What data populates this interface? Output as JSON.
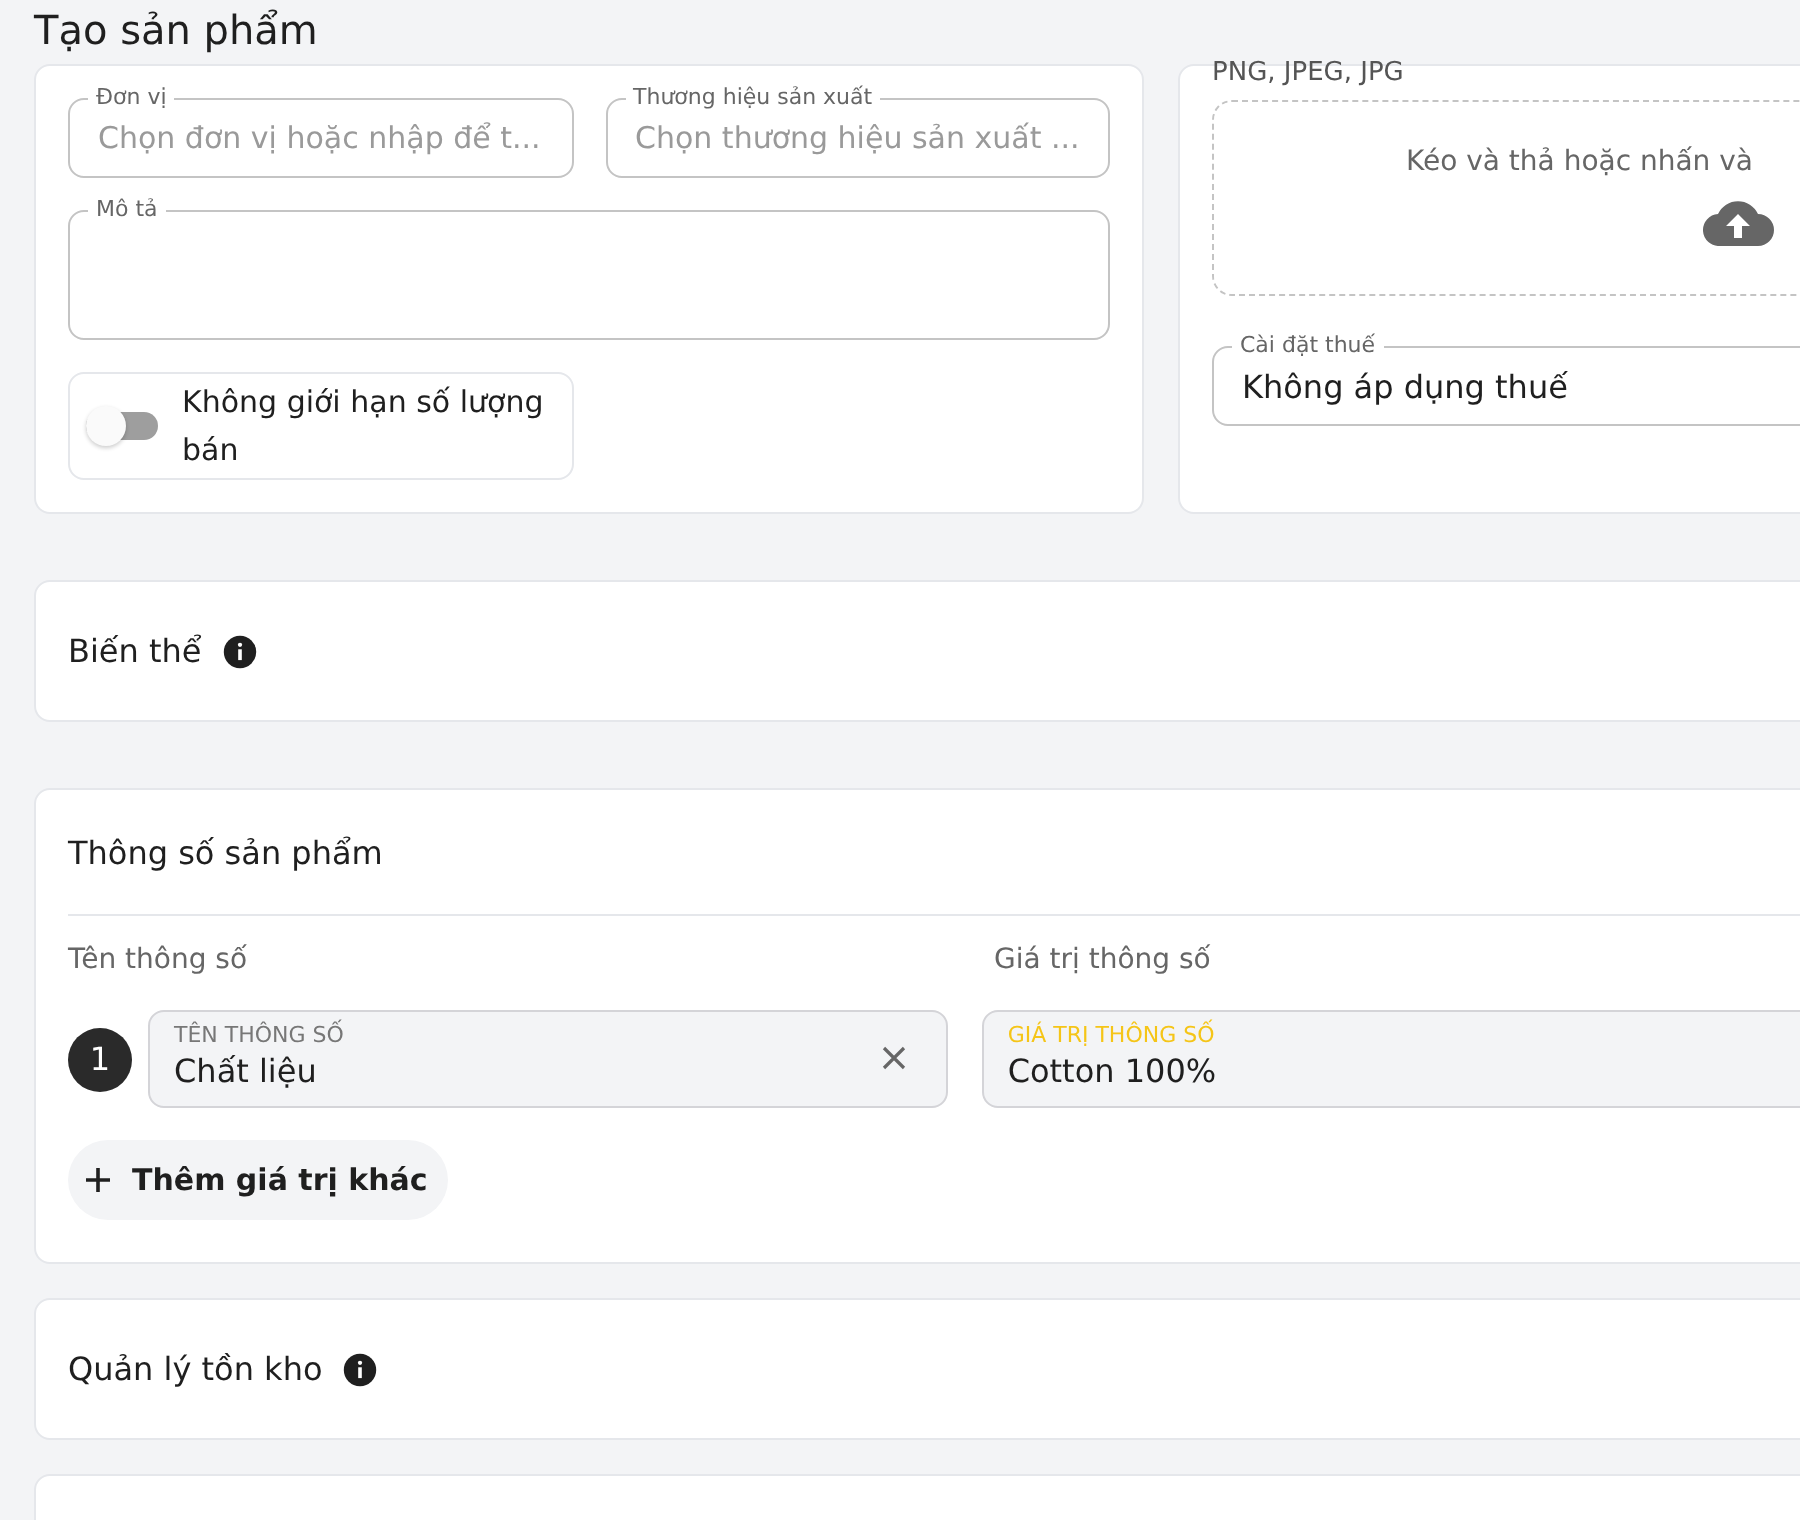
{
  "page_title": "Tạo sản phẩm",
  "general_card": {
    "unit_field": {
      "label": "Đơn vị",
      "placeholder": "Chọn đơn vị hoặc nhập để t..."
    },
    "brand_field": {
      "label": "Thương hiệu sản xuất",
      "placeholder": "Chọn thương hiệu sản xuất ..."
    },
    "description_field": {
      "label": "Mô tả"
    },
    "unlimited_toggle": {
      "label": "Không giới hạn số lượng bán",
      "on": false
    }
  },
  "media_card": {
    "formats": "PNG, JPEG, JPG",
    "dropzone_text": "Kéo và thả hoặc nhấn và",
    "tax_field": {
      "label": "Cài đặt thuế",
      "value": "Không áp dụng thuế"
    }
  },
  "variants_section": {
    "title": "Biến thể"
  },
  "specs_section": {
    "title": "Thông số sản phẩm",
    "columns": [
      "Tên thông số",
      "Giá trị thông số"
    ],
    "rows": [
      {
        "index": "1",
        "name_label": "TÊN THÔNG SỐ",
        "name": "Chất liệu",
        "value_label": "GIÁ TRỊ THÔNG SỐ",
        "value": "Cotton 100%",
        "focused": true
      }
    ],
    "add_button": "Thêm giá trị khác"
  },
  "inventory_section": {
    "title": "Quản lý tồn kho"
  }
}
